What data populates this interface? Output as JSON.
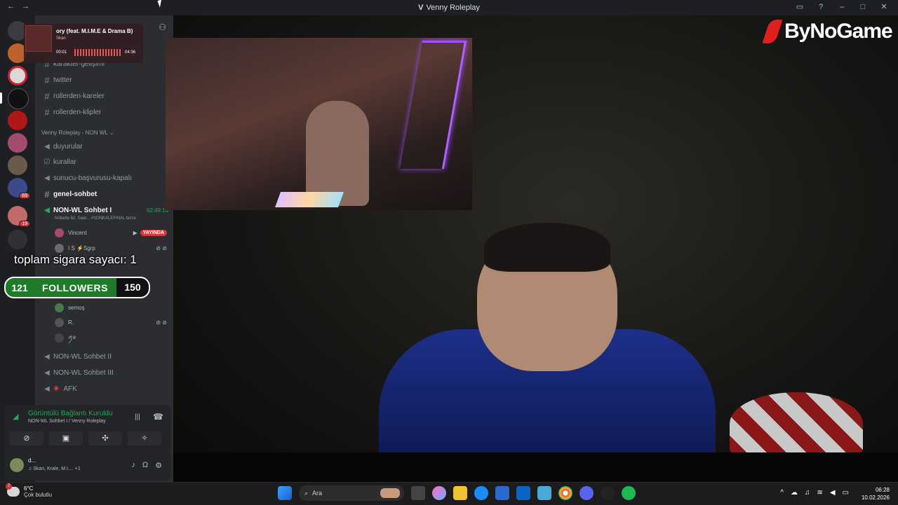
{
  "window": {
    "title": "Venny Roleplay",
    "back_icon": "←",
    "forward_icon": "→"
  },
  "music": {
    "song": "ory (feat. M.I.M.E & Drama B)",
    "artist": "Skan",
    "elapsed": "00:01",
    "total": "04:36"
  },
  "server": {
    "name": "Venny Roleplay"
  },
  "channels": {
    "text_top": [
      {
        "name": "karakter-gelişimi"
      },
      {
        "name": "twitter"
      },
      {
        "name": "rollerden-kareler"
      },
      {
        "name": "rollerden-klipler"
      }
    ],
    "category": "Venny Roleplay - NON WL",
    "category_items": [
      {
        "name": "duyurular",
        "type": "announce"
      },
      {
        "name": "kurallar",
        "type": "rules"
      },
      {
        "name": "sunucu-başvurusu-kapalı",
        "type": "announce"
      },
      {
        "name": "genel-sohbet",
        "type": "text"
      }
    ],
    "active_voice": {
      "name": "NON-WL Sohbet I",
      "timer": "62:49:16",
      "status": "Nöbette 62. Saat... #SONKALEFINAL bizce"
    },
    "voice_users": [
      {
        "name": "Vincent",
        "live": "YAYINDA"
      },
      {
        "name": "I S ⚡Sgrp"
      },
      {
        "name": "semoş"
      },
      {
        "name": "R."
      },
      {
        "name": "ꪑꫀ"
      }
    ],
    "other_voice": [
      {
        "name": "NON-WL Sohbet II"
      },
      {
        "name": "NON-WL Sohbet III"
      },
      {
        "name": "AFK"
      }
    ]
  },
  "voice_panel": {
    "status": "Görüntülü Bağlantı Kuruldu",
    "sub": "NON-WL Sohbet I / Venny Roleplay"
  },
  "user": {
    "name": "d...",
    "activity": "♫ Skan, Krale, M.I....",
    "extra": "+1"
  },
  "overlay": {
    "smoke_counter": "toplam sigara sayacı: 1",
    "followers_current": "121",
    "followers_label": "FOLLOWERS",
    "followers_goal": "150"
  },
  "logo": {
    "text": "ByNoGame"
  },
  "taskbar": {
    "temp": "6°C",
    "weather": "Çok bulutlu",
    "weather_badge": "7",
    "search_placeholder": "Ara",
    "time": "06:28",
    "date": "10.02.2026"
  },
  "colors": {
    "discord_bg": "#2b2d31",
    "server_rail": "#1e1f22",
    "accent_green": "#23a55a",
    "live_red": "#da373c",
    "brand_red": "#e02020"
  }
}
